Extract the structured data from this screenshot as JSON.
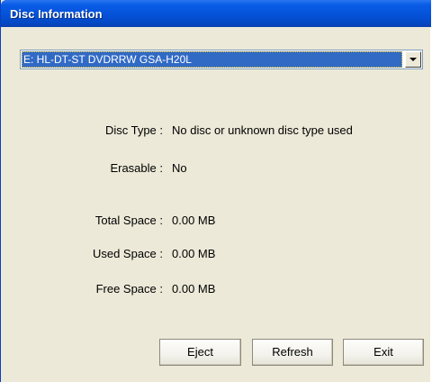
{
  "window": {
    "title": "Disc Information"
  },
  "drive_select": {
    "selected": "E: HL-DT-ST DVDRRW GSA-H20L"
  },
  "info": {
    "disc_type_label": "Disc Type :",
    "disc_type_value": "No disc or unknown disc type used",
    "erasable_label": "Erasable :",
    "erasable_value": "No",
    "total_space_label": "Total Space :",
    "total_space_value": "0.00 MB",
    "used_space_label": "Used Space :",
    "used_space_value": "0.00 MB",
    "free_space_label": "Free Space :",
    "free_space_value": "0.00 MB"
  },
  "buttons": {
    "eject": "Eject",
    "refresh": "Refresh",
    "exit": "Exit"
  },
  "colors": {
    "titlebar": "#0452d8",
    "selection": "#316ac5",
    "dialog_bg": "#ece9d8"
  }
}
